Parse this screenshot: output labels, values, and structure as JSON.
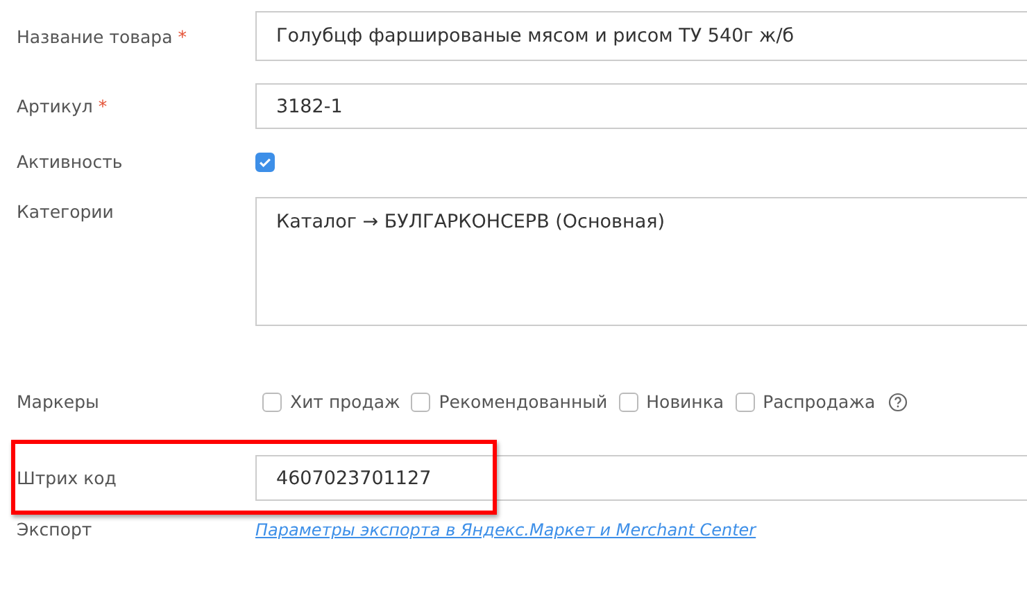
{
  "fields": [
    {
      "kind": "text",
      "label": "Название товара",
      "required_mark": "*",
      "value": "Голубцф фаршированые мясом и рисом ТУ 540г ж/б",
      "highlighted": false
    },
    {
      "kind": "text",
      "label": "Артикул",
      "required_mark": "*",
      "value": "3182-1",
      "highlighted": false
    },
    {
      "kind": "checkbox",
      "label": "Активность",
      "checked": true
    },
    {
      "kind": "textarea",
      "label": "Категории",
      "value": "Каталог → БУЛГАРКОНСЕРВ (Основная)"
    },
    {
      "kind": "markers",
      "label": "Маркеры",
      "options": [
        {
          "label": "Хит продаж",
          "checked": false
        },
        {
          "label": "Рекомендованный",
          "checked": false
        },
        {
          "label": "Новинка",
          "checked": false
        },
        {
          "label": "Распродажа",
          "checked": false
        }
      ]
    },
    {
      "kind": "text",
      "label": "Штрих код",
      "value": "4607023701127",
      "highlighted": true
    },
    {
      "kind": "link",
      "label": "Экспорт",
      "link": "Параметры экспорта в Яндекс.Маркет и Merchant Center"
    }
  ]
}
